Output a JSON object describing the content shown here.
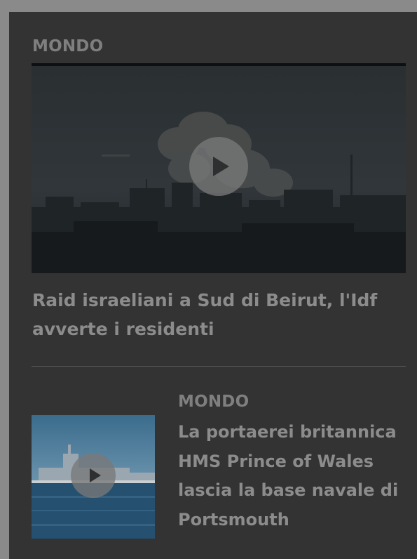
{
  "featured": {
    "category": "MONDO",
    "title": "Raid israeliani a Sud di Beirut, l'Idf avverte i residenti",
    "play_icon": "play-icon"
  },
  "second": {
    "category": "MONDO",
    "title": "La portaerei britannica HMS Prince of Wales lascia la base navale di Portsmouth",
    "play_icon": "play-icon"
  },
  "colors": {
    "panel": "#333333",
    "overlay": "#8a8a8a",
    "text": "#8c8c8c",
    "category": "#7f7f7f"
  }
}
